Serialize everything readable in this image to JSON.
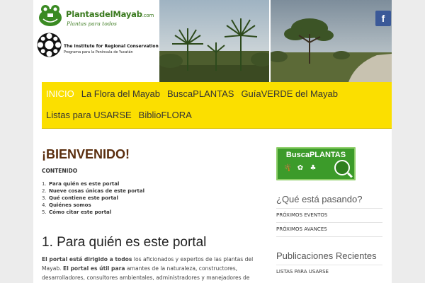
{
  "header": {
    "logo_name": "PlantasdelMayab",
    "logo_suffix": ".com",
    "logo_tagline": "Plantas para todos",
    "institute_name": "The Institute for Regional Conservation",
    "institute_program": "Programa para la Península de Yucatán",
    "social_icon": "facebook-icon",
    "social_glyph": "f"
  },
  "nav": {
    "row1": [
      "INICIO",
      "La Flora del Mayab",
      "BuscaPLANTAS",
      "GuíaVERDE del Mayab"
    ],
    "row2": [
      "Listas para USARSE",
      "BiblioFLORA"
    ],
    "active": "INICIO"
  },
  "main": {
    "welcome": "¡BIENVENIDO!",
    "contenido": "CONTENIDO",
    "toc": [
      "Para quién es este portal",
      "Nueve cosas únicas de este portal",
      "Qué contiene este portal",
      "Quiénes somos",
      "Cómo citar este portal"
    ],
    "section_title": "1. Para quién es este portal",
    "body_bold_1": "El portal está dirigido a todos",
    "body_text_1": " los aficionados y expertos de las plantas del Mayab. ",
    "body_bold_2": "El portal es útil para",
    "body_text_2": " amantes de la naturaleza, constructores, desarrolladores, consultores ambientales, administradores y manejadores de"
  },
  "sidebar": {
    "banner_title": "BuscaPLANTAS",
    "heading_1": "¿Qué está pasando?",
    "links_1": [
      "PRÓXIMOS EVENTOS",
      "PRÓXIMOS AVANCES"
    ],
    "heading_2": "Publicaciones Recientes",
    "links_2": [
      "LISTAS PARA USARSE"
    ]
  },
  "colors": {
    "nav_bg": "#fbdf00",
    "welcome": "#5a2e0e",
    "banner": "#3c9b2a",
    "facebook": "#3b5998"
  }
}
